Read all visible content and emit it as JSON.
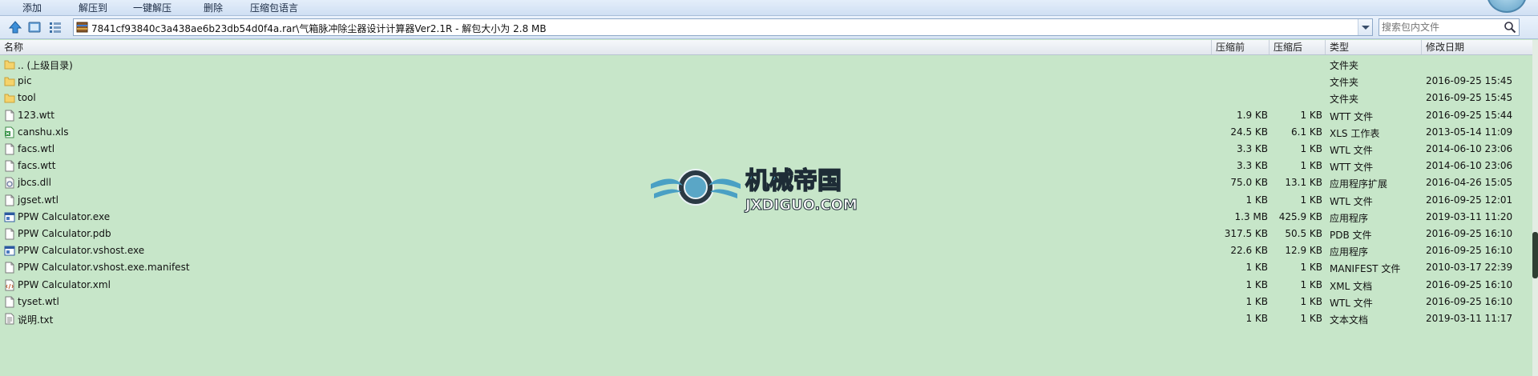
{
  "toolbar": {
    "buttons": [
      "添加",
      "解压到",
      "一键解压",
      "删除",
      "压缩包语言"
    ]
  },
  "address": {
    "path": "7841cf93840c3a438ae6b23db54d0f4a.rar\\气箱脉冲除尘器设计计算器Ver2.1R - 解包大小为 2.8 MB",
    "search_placeholder": "搜索包内文件"
  },
  "columns": {
    "name": "名称",
    "size": "压缩前",
    "packed": "压缩后",
    "type": "类型",
    "modified": "修改日期"
  },
  "files": [
    {
      "icon": "folder-icon",
      "name": ".. (上级目录)",
      "size": "",
      "packed": "",
      "type": "文件夹",
      "modified": ""
    },
    {
      "icon": "folder-icon",
      "name": "pic",
      "size": "",
      "packed": "",
      "type": "文件夹",
      "modified": "2016-09-25 15:45"
    },
    {
      "icon": "folder-icon",
      "name": "tool",
      "size": "",
      "packed": "",
      "type": "文件夹",
      "modified": "2016-09-25 15:45"
    },
    {
      "icon": "document-icon",
      "name": "123.wtt",
      "size": "1.9 KB",
      "packed": "1 KB",
      "type": "WTT 文件",
      "modified": "2016-09-25 15:44"
    },
    {
      "icon": "spreadsheet-icon",
      "name": "canshu.xls",
      "size": "24.5 KB",
      "packed": "6.1 KB",
      "type": "XLS 工作表",
      "modified": "2013-05-14 11:09"
    },
    {
      "icon": "document-icon",
      "name": "facs.wtl",
      "size": "3.3 KB",
      "packed": "1 KB",
      "type": "WTL 文件",
      "modified": "2014-06-10 23:06"
    },
    {
      "icon": "document-icon",
      "name": "facs.wtt",
      "size": "3.3 KB",
      "packed": "1 KB",
      "type": "WTT 文件",
      "modified": "2014-06-10 23:06"
    },
    {
      "icon": "dll-icon",
      "name": "jbcs.dll",
      "size": "75.0 KB",
      "packed": "13.1 KB",
      "type": "应用程序扩展",
      "modified": "2016-04-26 15:05"
    },
    {
      "icon": "document-icon",
      "name": "jgset.wtl",
      "size": "1 KB",
      "packed": "1 KB",
      "type": "WTL 文件",
      "modified": "2016-09-25 12:01"
    },
    {
      "icon": "application-icon",
      "name": "PPW Calculator.exe",
      "size": "1.3 MB",
      "packed": "425.9 KB",
      "type": "应用程序",
      "modified": "2019-03-11 11:20"
    },
    {
      "icon": "document-icon",
      "name": "PPW Calculator.pdb",
      "size": "317.5 KB",
      "packed": "50.5 KB",
      "type": "PDB 文件",
      "modified": "2016-09-25 16:10"
    },
    {
      "icon": "application-icon",
      "name": "PPW Calculator.vshost.exe",
      "size": "22.6 KB",
      "packed": "12.9 KB",
      "type": "应用程序",
      "modified": "2016-09-25 16:10"
    },
    {
      "icon": "document-icon",
      "name": "PPW Calculator.vshost.exe.manifest",
      "size": "1 KB",
      "packed": "1 KB",
      "type": "MANIFEST 文件",
      "modified": "2010-03-17 22:39"
    },
    {
      "icon": "xml-icon",
      "name": "PPW Calculator.xml",
      "size": "1 KB",
      "packed": "1 KB",
      "type": "XML 文档",
      "modified": "2016-09-25 16:10"
    },
    {
      "icon": "document-icon",
      "name": "tyset.wtl",
      "size": "1 KB",
      "packed": "1 KB",
      "type": "WTL 文件",
      "modified": "2016-09-25 16:10"
    },
    {
      "icon": "text-file-icon",
      "name": "说明.txt",
      "size": "1 KB",
      "packed": "1 KB",
      "type": "文本文档",
      "modified": "2019-03-11 11:17"
    }
  ],
  "watermark": {
    "title": "机械帝国",
    "url": "JXDIGUO.COM"
  },
  "colors": {
    "list_background": "#c7e6c9",
    "toolbar_background": "#dbe7f6",
    "folder": "#f5d36b"
  }
}
